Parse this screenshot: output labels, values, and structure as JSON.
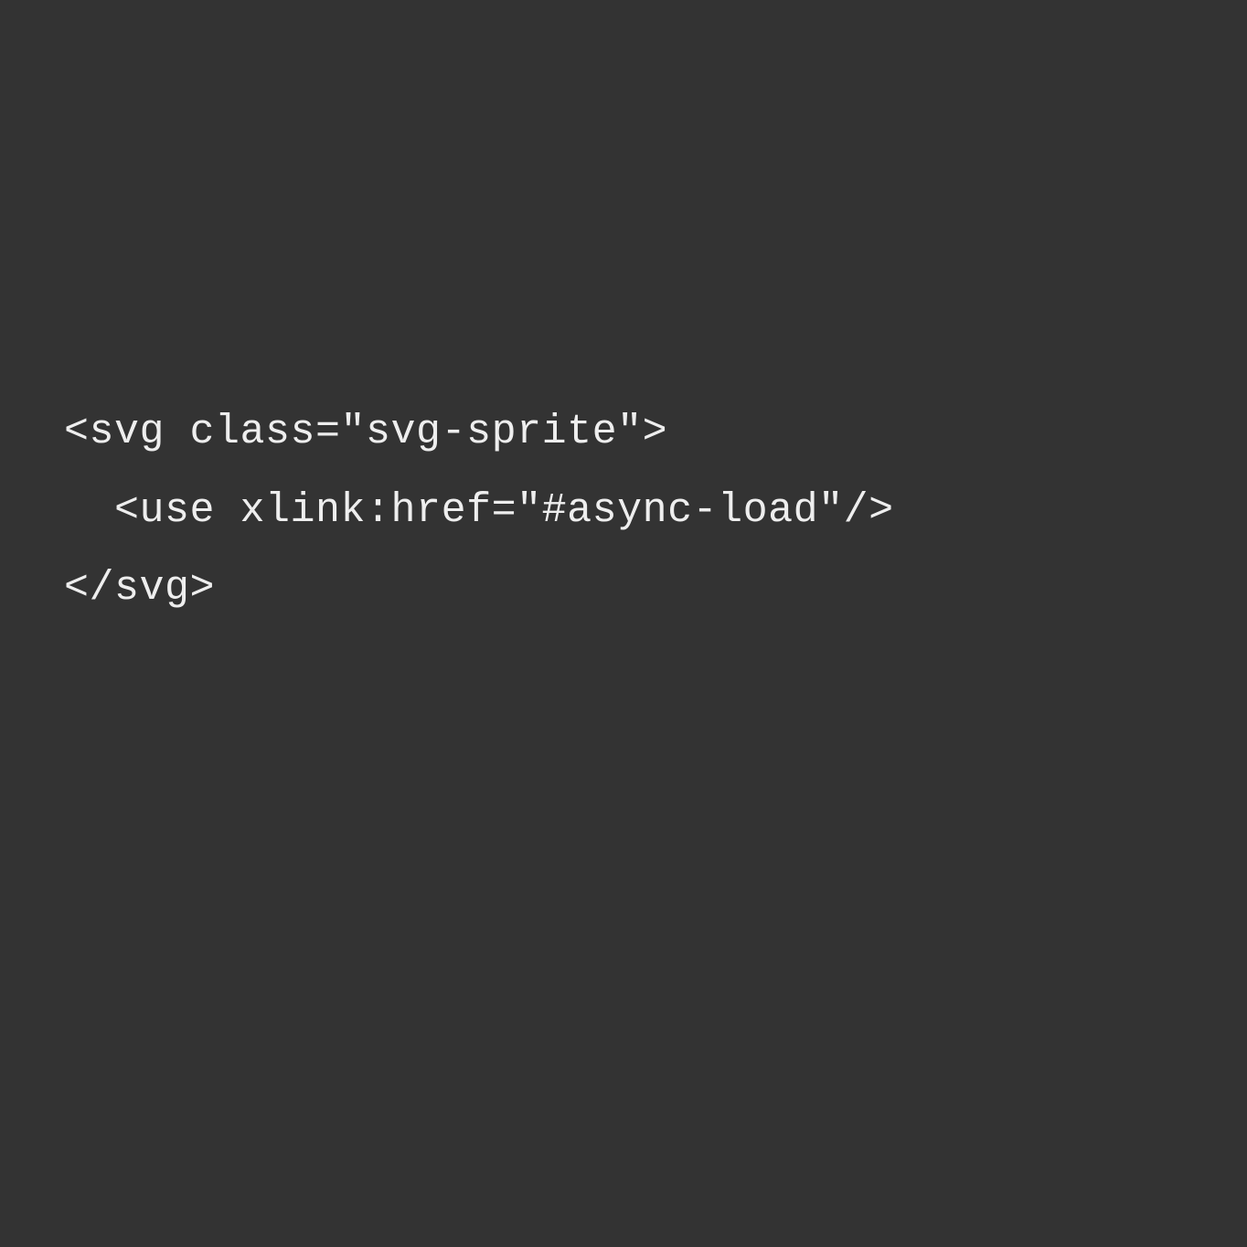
{
  "code": {
    "line1": "<svg class=\"svg-sprite\">",
    "line2": "  <use xlink:href=\"#async-load\"/>",
    "line3": "</svg>"
  }
}
